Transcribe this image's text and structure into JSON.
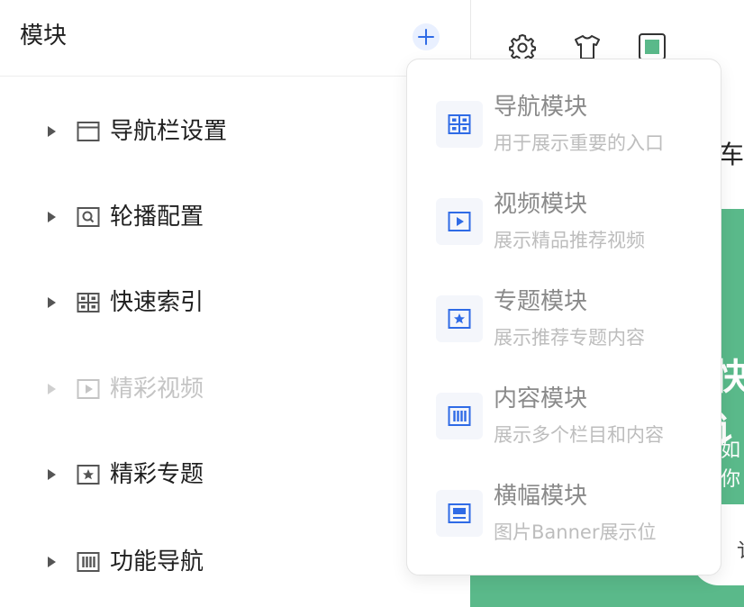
{
  "panel": {
    "title": "模块",
    "add_label": "+"
  },
  "tree": {
    "items": [
      {
        "label": "导航栏设置",
        "icon": "window-icon",
        "disabled": false
      },
      {
        "label": "轮播配置",
        "icon": "image-search-icon",
        "disabled": false
      },
      {
        "label": "快速索引",
        "icon": "grid-icon",
        "disabled": false
      },
      {
        "label": "精彩视频",
        "icon": "play-icon",
        "disabled": true
      },
      {
        "label": "精彩专题",
        "icon": "star-icon",
        "disabled": false
      },
      {
        "label": "功能导航",
        "icon": "columns-icon",
        "disabled": false
      }
    ]
  },
  "toolbar": {
    "icons": [
      "gear-icon",
      "tshirt-icon",
      "color-swatch-icon"
    ],
    "swatch_color": "#5ab98a"
  },
  "preview": {
    "snippet_1": "车",
    "snippet_2": "快讠",
    "snippet_3": "如你",
    "snippet_4": "讠"
  },
  "dropdown": {
    "items": [
      {
        "title": "导航模块",
        "desc": "用于展示重要的入口",
        "icon": "grid-icon"
      },
      {
        "title": "视频模块",
        "desc": "展示精品推荐视频",
        "icon": "play-icon"
      },
      {
        "title": "专题模块",
        "desc": "展示推荐专题内容",
        "icon": "star-icon"
      },
      {
        "title": "内容模块",
        "desc": "展示多个栏目和内容",
        "icon": "columns-icon"
      },
      {
        "title": "横幅模块",
        "desc": "图片Banner展示位",
        "icon": "banner-icon"
      }
    ]
  },
  "colors": {
    "accent": "#2f6be6",
    "green": "#5ab98a"
  }
}
